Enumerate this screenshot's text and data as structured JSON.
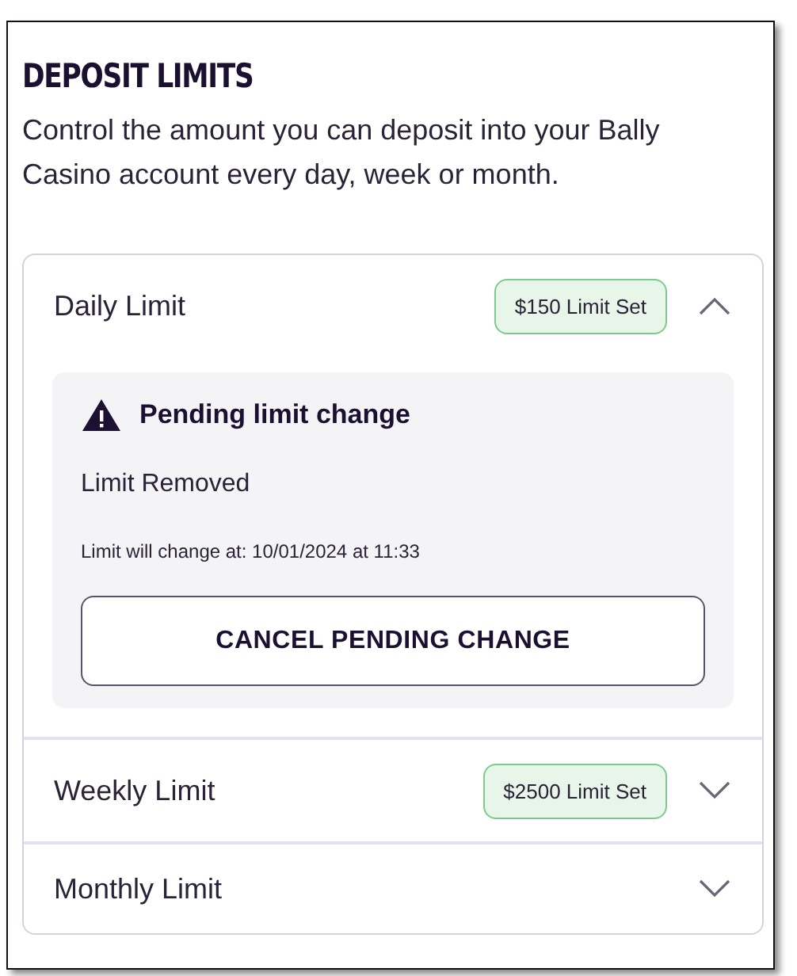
{
  "title": "DEPOSIT LIMITS",
  "description": "Control the amount you can deposit into your Bally Casino account every day, week or month.",
  "limits": [
    {
      "name": "Daily Limit",
      "badge": "$150 Limit Set",
      "expanded": true,
      "pending": {
        "title": "Pending limit change",
        "status": "Limit Removed",
        "note": "Limit will change at: 10/01/2024 at 11:33",
        "button": "CANCEL PENDING CHANGE"
      }
    },
    {
      "name": "Weekly Limit",
      "badge": "$2500 Limit Set",
      "expanded": false
    },
    {
      "name": "Monthly Limit",
      "expanded": false
    }
  ]
}
